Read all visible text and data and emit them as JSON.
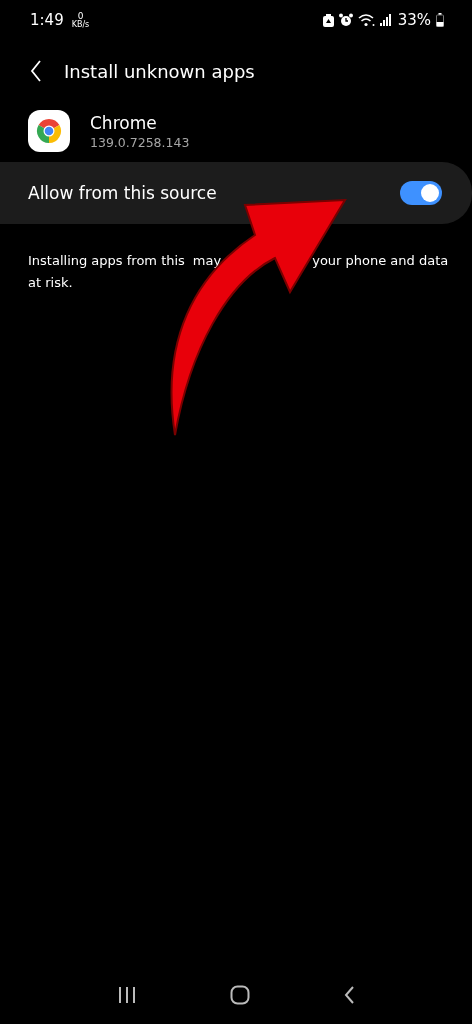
{
  "status_bar": {
    "time": "1:49",
    "speed_value": "0",
    "speed_unit": "KB/s",
    "battery": "33%"
  },
  "header": {
    "title": "Install unknown apps"
  },
  "app": {
    "name": "Chrome",
    "version": "139.0.7258.143"
  },
  "setting": {
    "label": "Allow from this source",
    "on": true
  },
  "description_fragments": [
    "Installing apps from this",
    "may",
    "your phone and data",
    "at risk."
  ]
}
